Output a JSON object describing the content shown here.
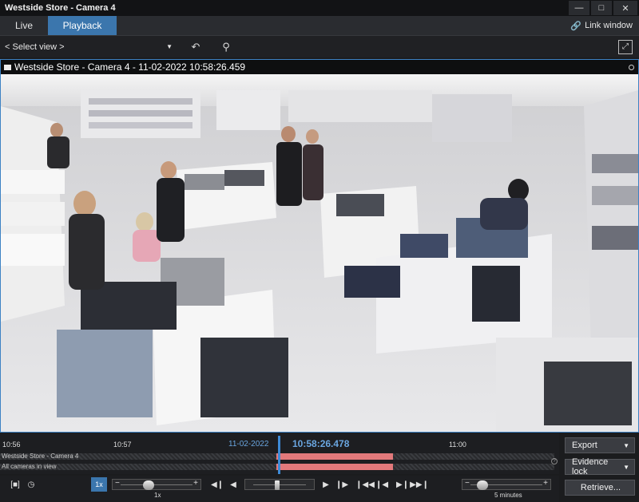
{
  "window": {
    "title": "Westside Store - Camera 4"
  },
  "tabs": [
    {
      "label": "Live"
    },
    {
      "label": "Playback"
    }
  ],
  "link_window": {
    "label": "Link window"
  },
  "toolbar": {
    "select_view": "< Select view >"
  },
  "tile": {
    "title": "Westside Store - Camera 4 - 11-02-2022 10:58:26.459"
  },
  "timeline": {
    "ticks": [
      {
        "label": "10:56"
      },
      {
        "label": "10:57"
      },
      {
        "label": "11:00"
      }
    ],
    "date": "11-02-2022",
    "current_time": "10:58:26.478",
    "tracks": [
      {
        "label": "Westside Store - Camera 4"
      },
      {
        "label": "All cameras in view"
      }
    ],
    "help": "?"
  },
  "side_buttons": {
    "export": "Export",
    "evidence_lock": "Evidence lock",
    "retrieve": "Retrieve..."
  },
  "controls": {
    "speed_value": "1x",
    "speed_label": "1x",
    "interval_label": "5 minutes"
  }
}
